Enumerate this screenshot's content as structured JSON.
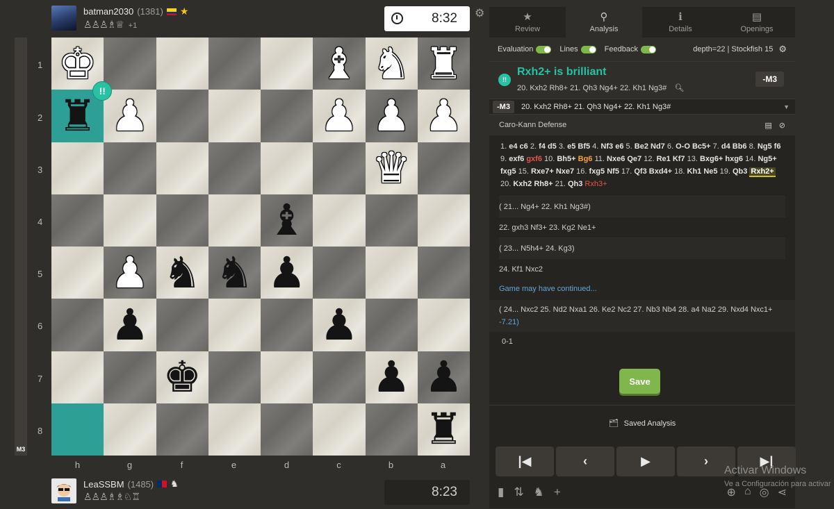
{
  "top_player": {
    "name": "batman2030",
    "rating": "(1381)",
    "captured": "♙♙♙♗♕",
    "extra": "+1",
    "clock": "8:32"
  },
  "bottom_player": {
    "name": "LeaSSBM",
    "rating": "(1485)",
    "captured": "♙♙♙♗♗♘♖",
    "clock": "8:23"
  },
  "evalbar": {
    "label": "M3"
  },
  "board": {
    "ranks": [
      "1",
      "2",
      "3",
      "4",
      "5",
      "6",
      "7",
      "8"
    ],
    "files": [
      "h",
      "g",
      "f",
      "e",
      "d",
      "c",
      "b",
      "a"
    ],
    "badge": "!!"
  },
  "tabs": [
    {
      "label": "Review",
      "icon": "★"
    },
    {
      "label": "Analysis",
      "icon": "⚲"
    },
    {
      "label": "Details",
      "icon": "ℹ"
    },
    {
      "label": "Openings",
      "icon": "▤"
    }
  ],
  "settings": {
    "evaluation": "Evaluation",
    "lines": "Lines",
    "feedback": "Feedback",
    "depth": "depth=22 | Stockfish 15"
  },
  "brilliant": {
    "title": "Rxh2+ is brilliant",
    "line": "20. Kxh2 Rh8+ 21. Qh3 Ng4+ 22. Kh1 Ng3#",
    "eval": "-M3"
  },
  "engine_line": {
    "eval": "-M3",
    "text": "20. Kxh2 Rh8+ 21. Qh3 Ng4+ 22. Kh1 Ng3#"
  },
  "opening": "Caro-Kann Defense",
  "variations": {
    "v1": "( 21... Ng4+ 22. Kh1 Ng3#)",
    "v2": "22. gxh3 Nf3+ 23. Kg2 Ne1+",
    "v3": "( 23... N5h4+ 24. Kg3)",
    "v4": "24. Kf1 Nxc2",
    "continued": "Game may have continued...",
    "v5_moves": "( 24... Nxc2 25. Nd2 Nxa1 26. Ke2 Nc2 27. Nb3 Nb4 28. a4 Na2 29. Nxd4 Nxc1+",
    "v5_eval": "-7.21)"
  },
  "result": "0-1",
  "save_label": "Save",
  "saved_analysis": "Saved Analysis",
  "windows": {
    "title": "Activar Windows",
    "sub": "Ve a Configuración para activar"
  }
}
